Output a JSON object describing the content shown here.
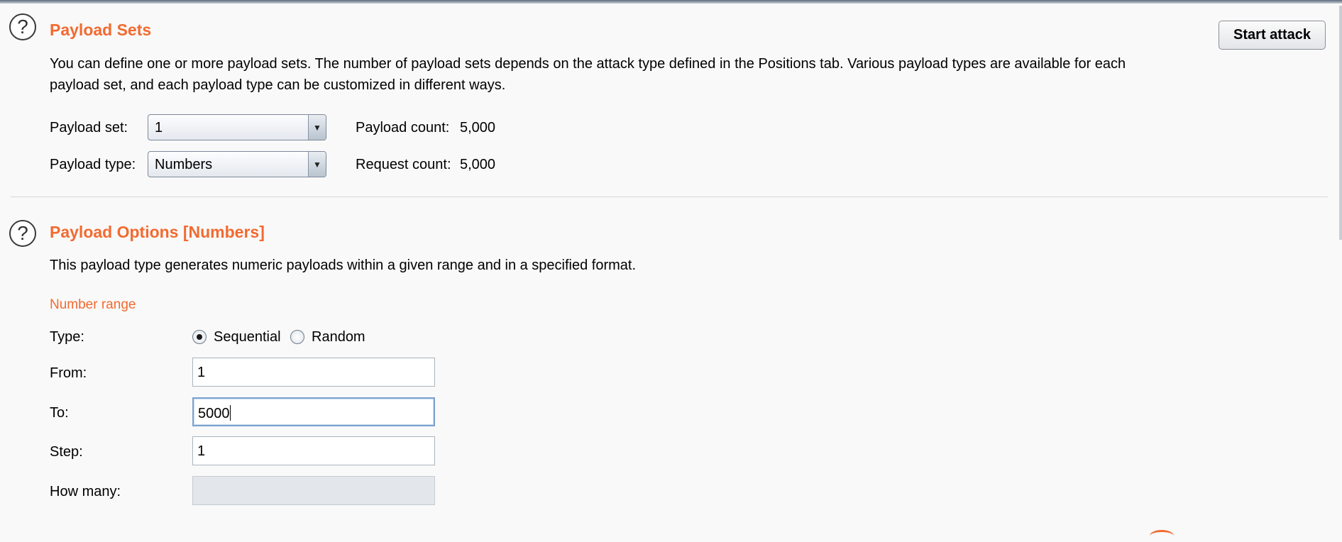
{
  "payload_sets": {
    "title": "Payload Sets",
    "description_line1": "You can define one or more payload sets. The number of payload sets depends on the attack type defined in the Positions tab. Various payload types are available for each",
    "description_line2": "payload set, and each payload type can be customized in different ways.",
    "payload_set_label": "Payload set:",
    "payload_set_value": "1",
    "payload_type_label": "Payload type:",
    "payload_type_value": "Numbers",
    "payload_count_label": "Payload count:",
    "payload_count_value": "5,000",
    "request_count_label": "Request count:",
    "request_count_value": "5,000",
    "start_attack_label": "Start attack",
    "help_icon": "?"
  },
  "payload_options": {
    "title": "Payload Options [Numbers]",
    "description": "This payload type generates numeric payloads within a given range and in a specified format.",
    "help_icon": "?",
    "number_range_label": "Number range",
    "type_label": "Type:",
    "type_options": [
      "Sequential",
      "Random"
    ],
    "type_selected": "Sequential",
    "from_label": "From:",
    "from_value": "1",
    "to_label": "To:",
    "to_value": "5000",
    "step_label": "Step:",
    "step_value": "1",
    "how_many_label": "How many:",
    "how_many_value": ""
  },
  "colors": {
    "accent": "#f26a30",
    "background": "#f9f9f9"
  }
}
